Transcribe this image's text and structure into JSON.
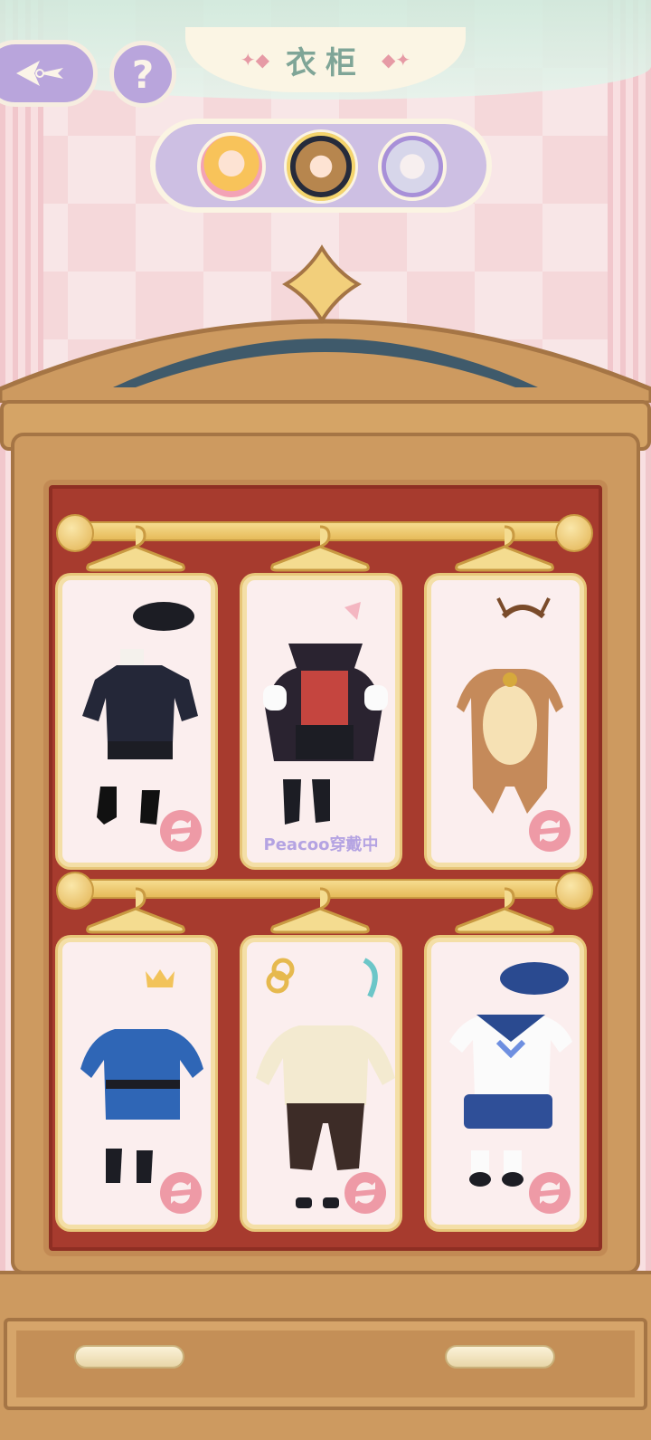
{
  "header": {
    "title": "衣柜",
    "back_icon": "back-arrow-icon",
    "help_label": "?"
  },
  "characters": [
    {
      "name": "blonde-girl-avatar",
      "selected": false
    },
    {
      "name": "brown-hair-beret-avatar",
      "selected": true
    },
    {
      "name": "silver-hair-avatar",
      "selected": false
    }
  ],
  "outfits": [
    {
      "id": "navy-coat-outfit",
      "status": ""
    },
    {
      "id": "vampire-outfit",
      "status": "Peacoo穿戴中"
    },
    {
      "id": "reindeer-outfit",
      "status": ""
    },
    {
      "id": "prince-blue-outfit",
      "status": ""
    },
    {
      "id": "cream-chinese-outfit",
      "status": ""
    },
    {
      "id": "sailor-outfit",
      "status": ""
    }
  ],
  "colors": {
    "accent_purple": "#b9a5dc",
    "refresh_pink": "#ee9aa6",
    "wearing_text": "#b4a3e2",
    "wardrobe_wood": "#cd9a60",
    "wardrobe_interior": "#a73b2e"
  }
}
